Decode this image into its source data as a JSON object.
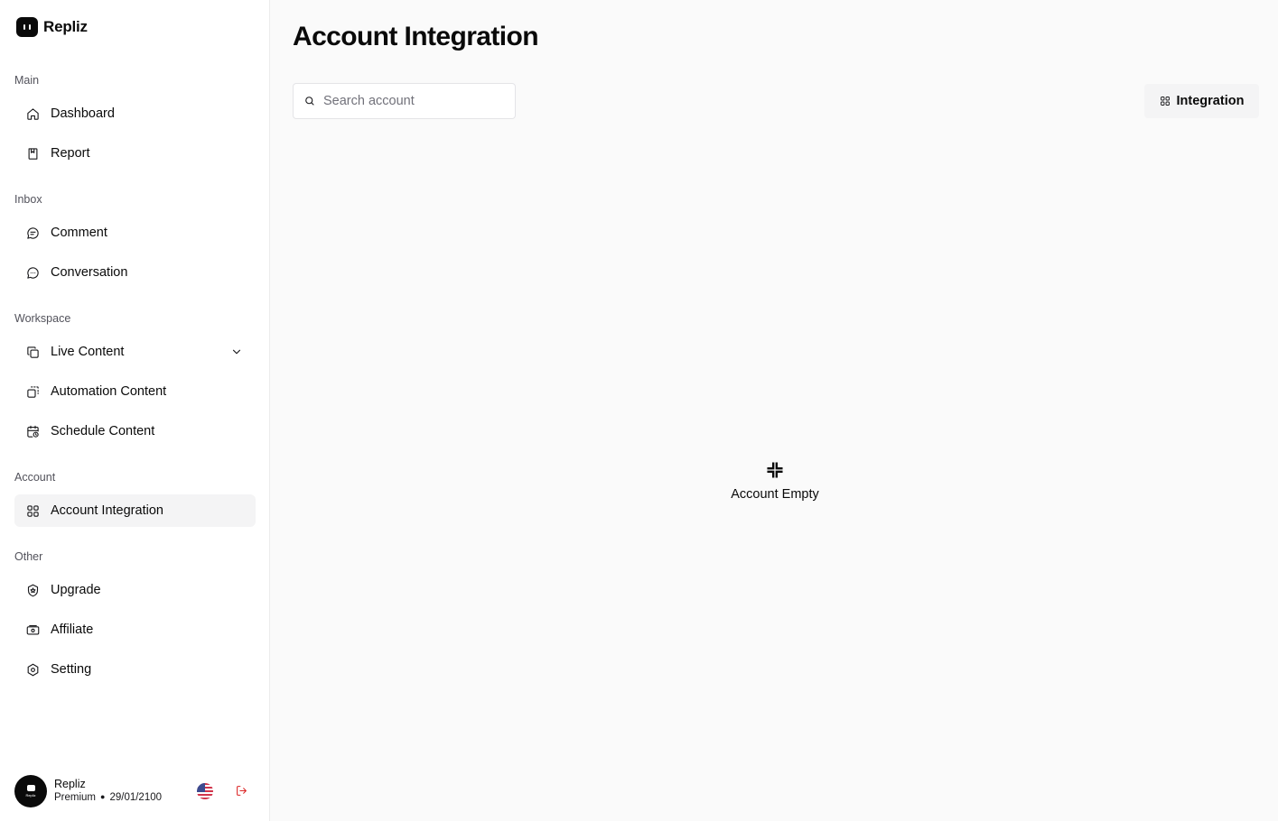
{
  "brand": {
    "name": "Repliz"
  },
  "sidebar": {
    "sections": [
      {
        "label": "Main",
        "items": [
          {
            "label": "Dashboard",
            "icon": "home-icon"
          },
          {
            "label": "Report",
            "icon": "book-icon"
          }
        ]
      },
      {
        "label": "Inbox",
        "items": [
          {
            "label": "Comment",
            "icon": "comment-icon"
          },
          {
            "label": "Conversation",
            "icon": "conversation-icon"
          }
        ]
      },
      {
        "label": "Workspace",
        "items": [
          {
            "label": "Live Content",
            "icon": "copy-icon"
          },
          {
            "label": "Automation Content",
            "icon": "automation-icon"
          },
          {
            "label": "Schedule Content",
            "icon": "calendar-clock-icon"
          }
        ]
      },
      {
        "label": "Account",
        "items": [
          {
            "label": "Account Integration",
            "icon": "grid-icon"
          }
        ]
      },
      {
        "label": "Other",
        "items": [
          {
            "label": "Upgrade",
            "icon": "shield-icon"
          },
          {
            "label": "Affiliate",
            "icon": "banknote-icon"
          },
          {
            "label": "Setting",
            "icon": "gear-icon"
          }
        ]
      }
    ],
    "active_item": "Account Integration"
  },
  "user": {
    "name": "Repliz",
    "plan": "Premium",
    "expiry": "29/01/2100",
    "avatar_text": "Repliz"
  },
  "main": {
    "title": "Account Integration",
    "search": {
      "placeholder": "Search account",
      "value": ""
    },
    "integration_button": "Integration",
    "empty_state": "Account Empty"
  },
  "colors": {
    "accent": "#0a0a0a",
    "active_bg": "#f4f4f5",
    "logout": "#dc2626",
    "background": "#fafafa"
  }
}
